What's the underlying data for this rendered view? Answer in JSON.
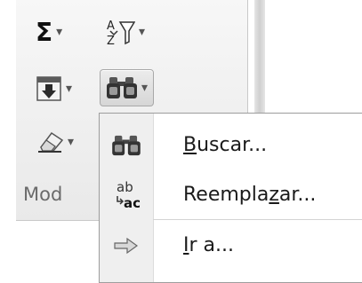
{
  "ribbon": {
    "group_label": "Mod",
    "buttons": {
      "autosum": {
        "icon": "sigma-icon",
        "glyph": "Σ"
      },
      "sort_filter": {
        "icon": "sort-filter-icon",
        "glyph_a": "A",
        "glyph_z": "Z"
      },
      "fill": {
        "icon": "fill-down-icon"
      },
      "find_select": {
        "icon": "binoculars-icon"
      },
      "clear": {
        "icon": "eraser-icon"
      }
    }
  },
  "menu": {
    "items": [
      {
        "icon": "binoculars-icon",
        "pre": "",
        "key": "B",
        "post": "uscar..."
      },
      {
        "icon": "replace-icon",
        "icon_text_top": "ab",
        "icon_text_bottom": "ac",
        "pre": "Reempla",
        "key": "z",
        "post": "ar..."
      },
      {
        "icon": "arrow-right-icon",
        "pre": "",
        "key": "I",
        "post": "r a..."
      }
    ]
  },
  "colors": {
    "ribbon_bg": "#efefef",
    "menu_bg": "#ffffff",
    "gutter_bg": "#efefef"
  }
}
